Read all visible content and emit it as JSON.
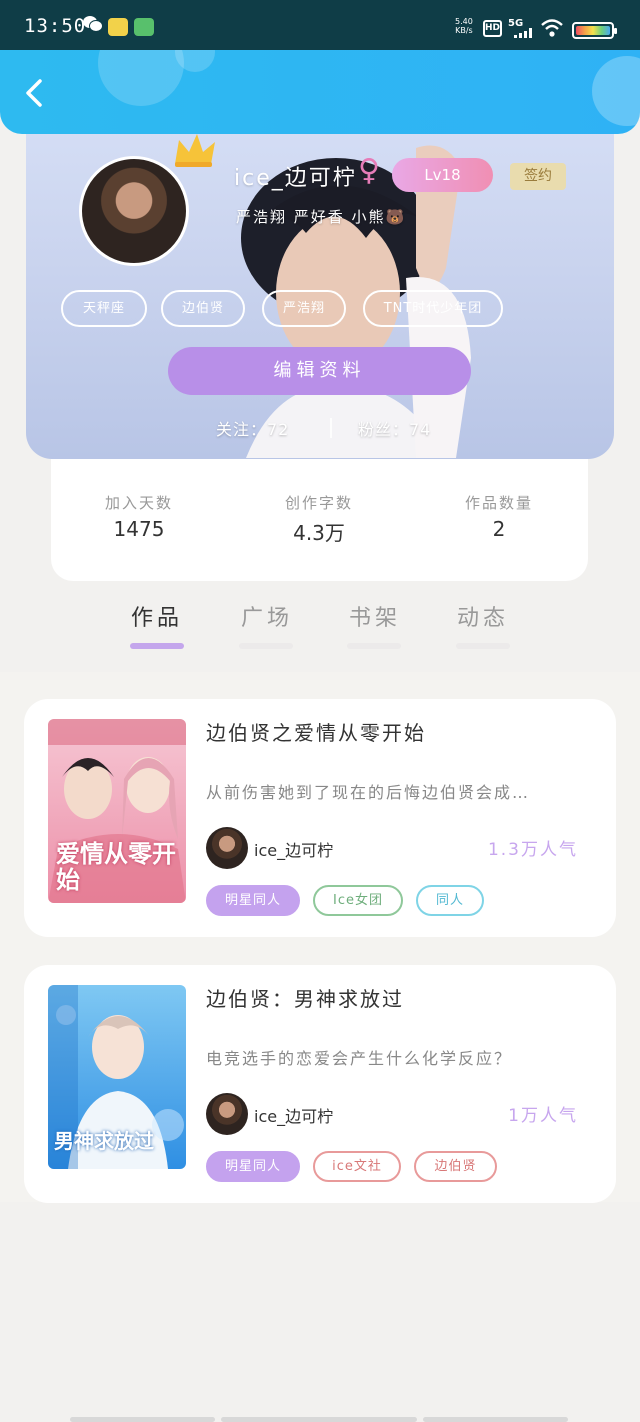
{
  "status_bar": {
    "time": "13:50",
    "net_speed": "5.40\nKB/s",
    "hd": "HD",
    "network": "5G"
  },
  "profile": {
    "username": "ice_边可柠",
    "gender_symbol": "♀",
    "level": "Lv18",
    "sign_label": "签约",
    "bio": "严浩翔 严好香 小熊🐻",
    "tags": [
      "天秤座",
      "边伯贤",
      "严浩翔",
      "TNT时代少年团"
    ],
    "edit_button": "编辑资料",
    "follow_label": "关注：72",
    "fans_label": "粉丝：74"
  },
  "stats": [
    {
      "label": "加入天数",
      "value": "1475"
    },
    {
      "label": "创作字数",
      "value": "4.3万"
    },
    {
      "label": "作品数量",
      "value": "2"
    }
  ],
  "tabs": [
    {
      "label": "作品",
      "active": true
    },
    {
      "label": "广场",
      "active": false
    },
    {
      "label": "书架",
      "active": false
    },
    {
      "label": "动态",
      "active": false
    }
  ],
  "books": [
    {
      "title": "边伯贤之爱情从零开始",
      "description": "从前伤害她到了现在的后悔边伯贤会成…",
      "author": "ice_边可柠",
      "popularity": "1.3万人气",
      "cover_text": "爱情从零开始",
      "tags": [
        {
          "label": "明星同人",
          "style": "filled",
          "color": "#c4a2ee"
        },
        {
          "label": "Ice女团",
          "style": "outline",
          "color": "#8fc89a"
        },
        {
          "label": "同人",
          "style": "outline",
          "color": "#7fd4e6"
        }
      ]
    },
    {
      "title": "边伯贤：男神求放过",
      "description": "电竞选手的恋爱会产生什么化学反应？",
      "author": "ice_边可柠",
      "popularity": "1万人气",
      "cover_text": "男神求放过",
      "tags": [
        {
          "label": "明星同人",
          "style": "filled",
          "color": "#c4a2ee"
        },
        {
          "label": "ice文社",
          "style": "outline",
          "color": "#e89a9a"
        },
        {
          "label": "边伯贤",
          "style": "outline",
          "color": "#e89a9a"
        }
      ]
    }
  ],
  "colors": {
    "header": "#2eb6f2",
    "accent": "#b88fe8",
    "popularity": "#c7a6ee"
  }
}
